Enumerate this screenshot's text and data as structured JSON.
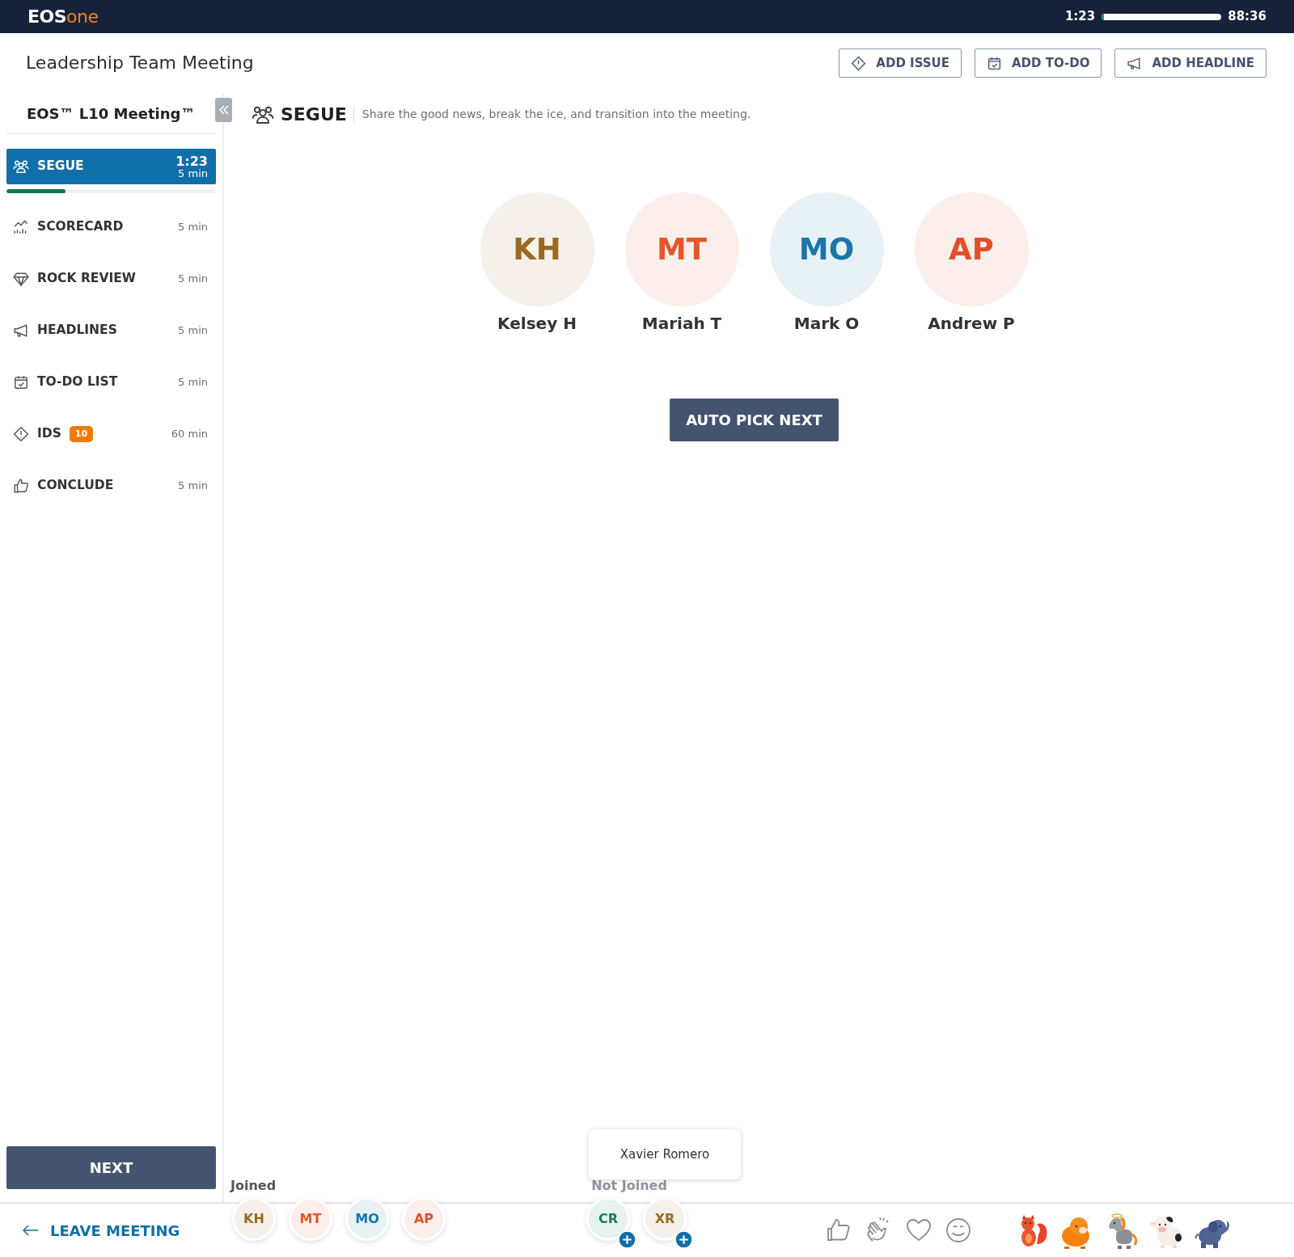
{
  "top_bar": {
    "logo": {
      "brand": "EOS",
      "suffix": "one"
    },
    "elapsed": "1:23",
    "level": 0.02,
    "remaining": "88:36"
  },
  "header": {
    "title": "Leadership Team Meeting",
    "actions": [
      {
        "kind": "issue",
        "label": "ADD ISSUE"
      },
      {
        "kind": "todo",
        "label": "ADD TO-DO"
      },
      {
        "kind": "headline",
        "label": "ADD HEADLINE"
      }
    ]
  },
  "sidebar": {
    "title": "EOS™ L10 Meeting™",
    "items": [
      {
        "kind": "segue",
        "label": "SEGUE",
        "selected": true,
        "elapsed": "1:23",
        "duration": "5 min",
        "level": 0.28
      },
      {
        "kind": "scorecard",
        "label": "SCORECARD",
        "selected": false,
        "duration": "5 min"
      },
      {
        "kind": "rock",
        "label": "ROCK REVIEW",
        "selected": false,
        "duration": "5 min"
      },
      {
        "kind": "headline",
        "label": "HEADLINES",
        "selected": false,
        "duration": "5 min"
      },
      {
        "kind": "todo",
        "label": "TO-DO LIST",
        "selected": false,
        "duration": "5 min"
      },
      {
        "kind": "issue",
        "label": "IDS",
        "badge": "10",
        "selected": false,
        "duration": "60 min"
      },
      {
        "kind": "conclude",
        "label": "CONCLUDE",
        "selected": false,
        "duration": "5 min"
      }
    ],
    "next_button": "NEXT",
    "leave_button": "LEAVE MEETING"
  },
  "section": {
    "title": "SEGUE",
    "description": "Share the good news, break the ice, and transition into the meeting."
  },
  "participants": [
    {
      "initials": "KH",
      "name": "Kelsey H",
      "color": "#9a6a22"
    },
    {
      "initials": "MT",
      "name": "Mariah T",
      "color": "#e2572b"
    },
    {
      "initials": "MO",
      "name": "Mark O",
      "color": "#1a76a8"
    },
    {
      "initials": "AP",
      "name": "Andrew P",
      "color": "#e0502a"
    }
  ],
  "auto_pick_button": "AUTO PICK NEXT",
  "attendance": {
    "joined_label": "Joined",
    "joined": [
      {
        "initials": "KH",
        "color": "#9a6a22"
      },
      {
        "initials": "MT",
        "color": "#e2572b"
      },
      {
        "initials": "MO",
        "color": "#1a76a8"
      },
      {
        "initials": "AP",
        "color": "#e0502a"
      }
    ],
    "not_joined_label": "Not Joined",
    "not_joined": [
      {
        "initials": "CR",
        "color": "#1c7a5a"
      },
      {
        "initials": "XR",
        "color": "#9a6a22"
      }
    ],
    "tooltip": "Xavier Romero"
  },
  "reactions": [
    {
      "kind": "thumbs-up"
    },
    {
      "kind": "clap"
    },
    {
      "kind": "heart"
    },
    {
      "kind": "smile"
    }
  ],
  "stickers": [
    {
      "kind": "squirrel"
    },
    {
      "kind": "bull"
    },
    {
      "kind": "horse"
    },
    {
      "kind": "cow"
    },
    {
      "kind": "elephant"
    }
  ]
}
